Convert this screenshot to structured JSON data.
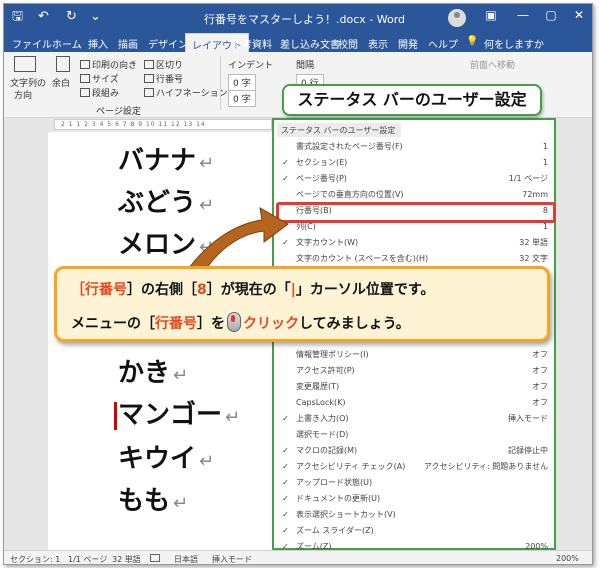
{
  "titlebar": {
    "title": "行番号をマスターしよう！.docx - Word",
    "qa_save": "🖫",
    "qa_undo": "↶",
    "qa_redo": "↻",
    "qa_more": "⌄",
    "wc_ribbon": "▣",
    "wc_min": "—",
    "wc_max": "▢",
    "wc_close": "✕"
  },
  "tabs": [
    "ファイル",
    "ホーム",
    "挿入",
    "描画",
    "デザイン",
    "レイアウト",
    "参考資料",
    "差し込み文書",
    "校閲",
    "表示",
    "開発",
    "ヘルプ",
    "何をしますか"
  ],
  "tabs_active": "レイアウト",
  "tellme_icon": "💡",
  "ribbon": {
    "text_dir": "文字列の",
    "text_dir2": "方向",
    "margins": "余白",
    "orientation": "印刷の向き",
    "size": "サイズ",
    "columns": "段組み",
    "breaks": "区切り",
    "line_numbers": "行番号",
    "hyphenation": "ハイフネーション",
    "indent": "インデント",
    "spacing": "間隔",
    "indent_left": "0 字",
    "indent_right": "0 字",
    "spacing_before": "0 行",
    "spacing_after": "0 行",
    "group_label": "ページ設定",
    "forward": "前面へ移動"
  },
  "document": {
    "lines": [
      "バナナ",
      "ぶどう",
      "メロン",
      "かき",
      "マンゴー",
      "キウイ",
      "もも"
    ],
    "para_mark": "↵"
  },
  "callout_title": "ステータス バーのユーザー設定",
  "instruction": {
    "p1": "［",
    "p2": "行番号",
    "p3": "］の右側［",
    "p4": "8",
    "p5": "］が現在の「",
    "p6": "|",
    "p7": "」カーソル位置です。",
    "q1": "メニューの［",
    "q2": "行番号",
    "q3": "］を",
    "q4": "クリック",
    "q5": "してみましょう。"
  },
  "menu": {
    "header": "ステータス バーのユーザー設定",
    "items": [
      {
        "check": "",
        "label": "書式設定されたページ番号(F)",
        "value": "1"
      },
      {
        "check": "✓",
        "label": "セクション(E)",
        "value": "1"
      },
      {
        "check": "✓",
        "label": "ページ番号(P)",
        "value": "1/1 ページ"
      },
      {
        "check": "",
        "label": "ページでの垂直方向の位置(V)",
        "value": "72mm"
      },
      {
        "check": "",
        "label": "行番号(B)",
        "value": "8"
      },
      {
        "check": "",
        "label": "列(C)",
        "value": "1"
      },
      {
        "check": "✓",
        "label": "文字カウント(W)",
        "value": "32 単語"
      },
      {
        "check": "",
        "label": "文字のカウント (スペースを含む)(H)",
        "value": "32 文字"
      },
      {
        "check": "",
        "label": "",
        "value": ""
      },
      {
        "check": "",
        "label": "",
        "value": ""
      },
      {
        "check": "",
        "label": "",
        "value": ""
      },
      {
        "check": "",
        "label": "",
        "value": ""
      },
      {
        "check": "",
        "label": "",
        "value": ""
      },
      {
        "check": "",
        "label": "情報管理ポリシー(I)",
        "value": "オフ"
      },
      {
        "check": "",
        "label": "アクセス許可(P)",
        "value": "オフ"
      },
      {
        "check": "",
        "label": "変更履歴(T)",
        "value": "オフ"
      },
      {
        "check": "",
        "label": "CapsLock(K)",
        "value": "オフ"
      },
      {
        "check": "✓",
        "label": "上書き入力(O)",
        "value": "挿入モード"
      },
      {
        "check": "",
        "label": "選択モード(D)",
        "value": ""
      },
      {
        "check": "✓",
        "label": "マクロの記録(M)",
        "value": "記録停止中"
      },
      {
        "check": "✓",
        "label": "アクセシビリティ チェック(A)",
        "value": "アクセシビリティ: 問題ありません"
      },
      {
        "check": "✓",
        "label": "アップロード状態(U)",
        "value": ""
      },
      {
        "check": "✓",
        "label": "ドキュメントの更新(U)",
        "value": ""
      },
      {
        "check": "✓",
        "label": "表示選択ショートカット(V)",
        "value": ""
      },
      {
        "check": "✓",
        "label": "ズーム スライダー(Z)",
        "value": ""
      },
      {
        "check": "✓",
        "label": "ズーム(Z)",
        "value": "200%"
      }
    ]
  },
  "statusbar": {
    "section": "セクション: 1",
    "page": "1/1 ページ",
    "words": "32 単語",
    "language": "日本語",
    "mode": "挿入モード",
    "zoom": "200%"
  },
  "colors": {
    "word_blue": "#2b579a",
    "green_border": "#43a047",
    "red_highlight": "#e53935",
    "orange_border": "#f5a623"
  }
}
